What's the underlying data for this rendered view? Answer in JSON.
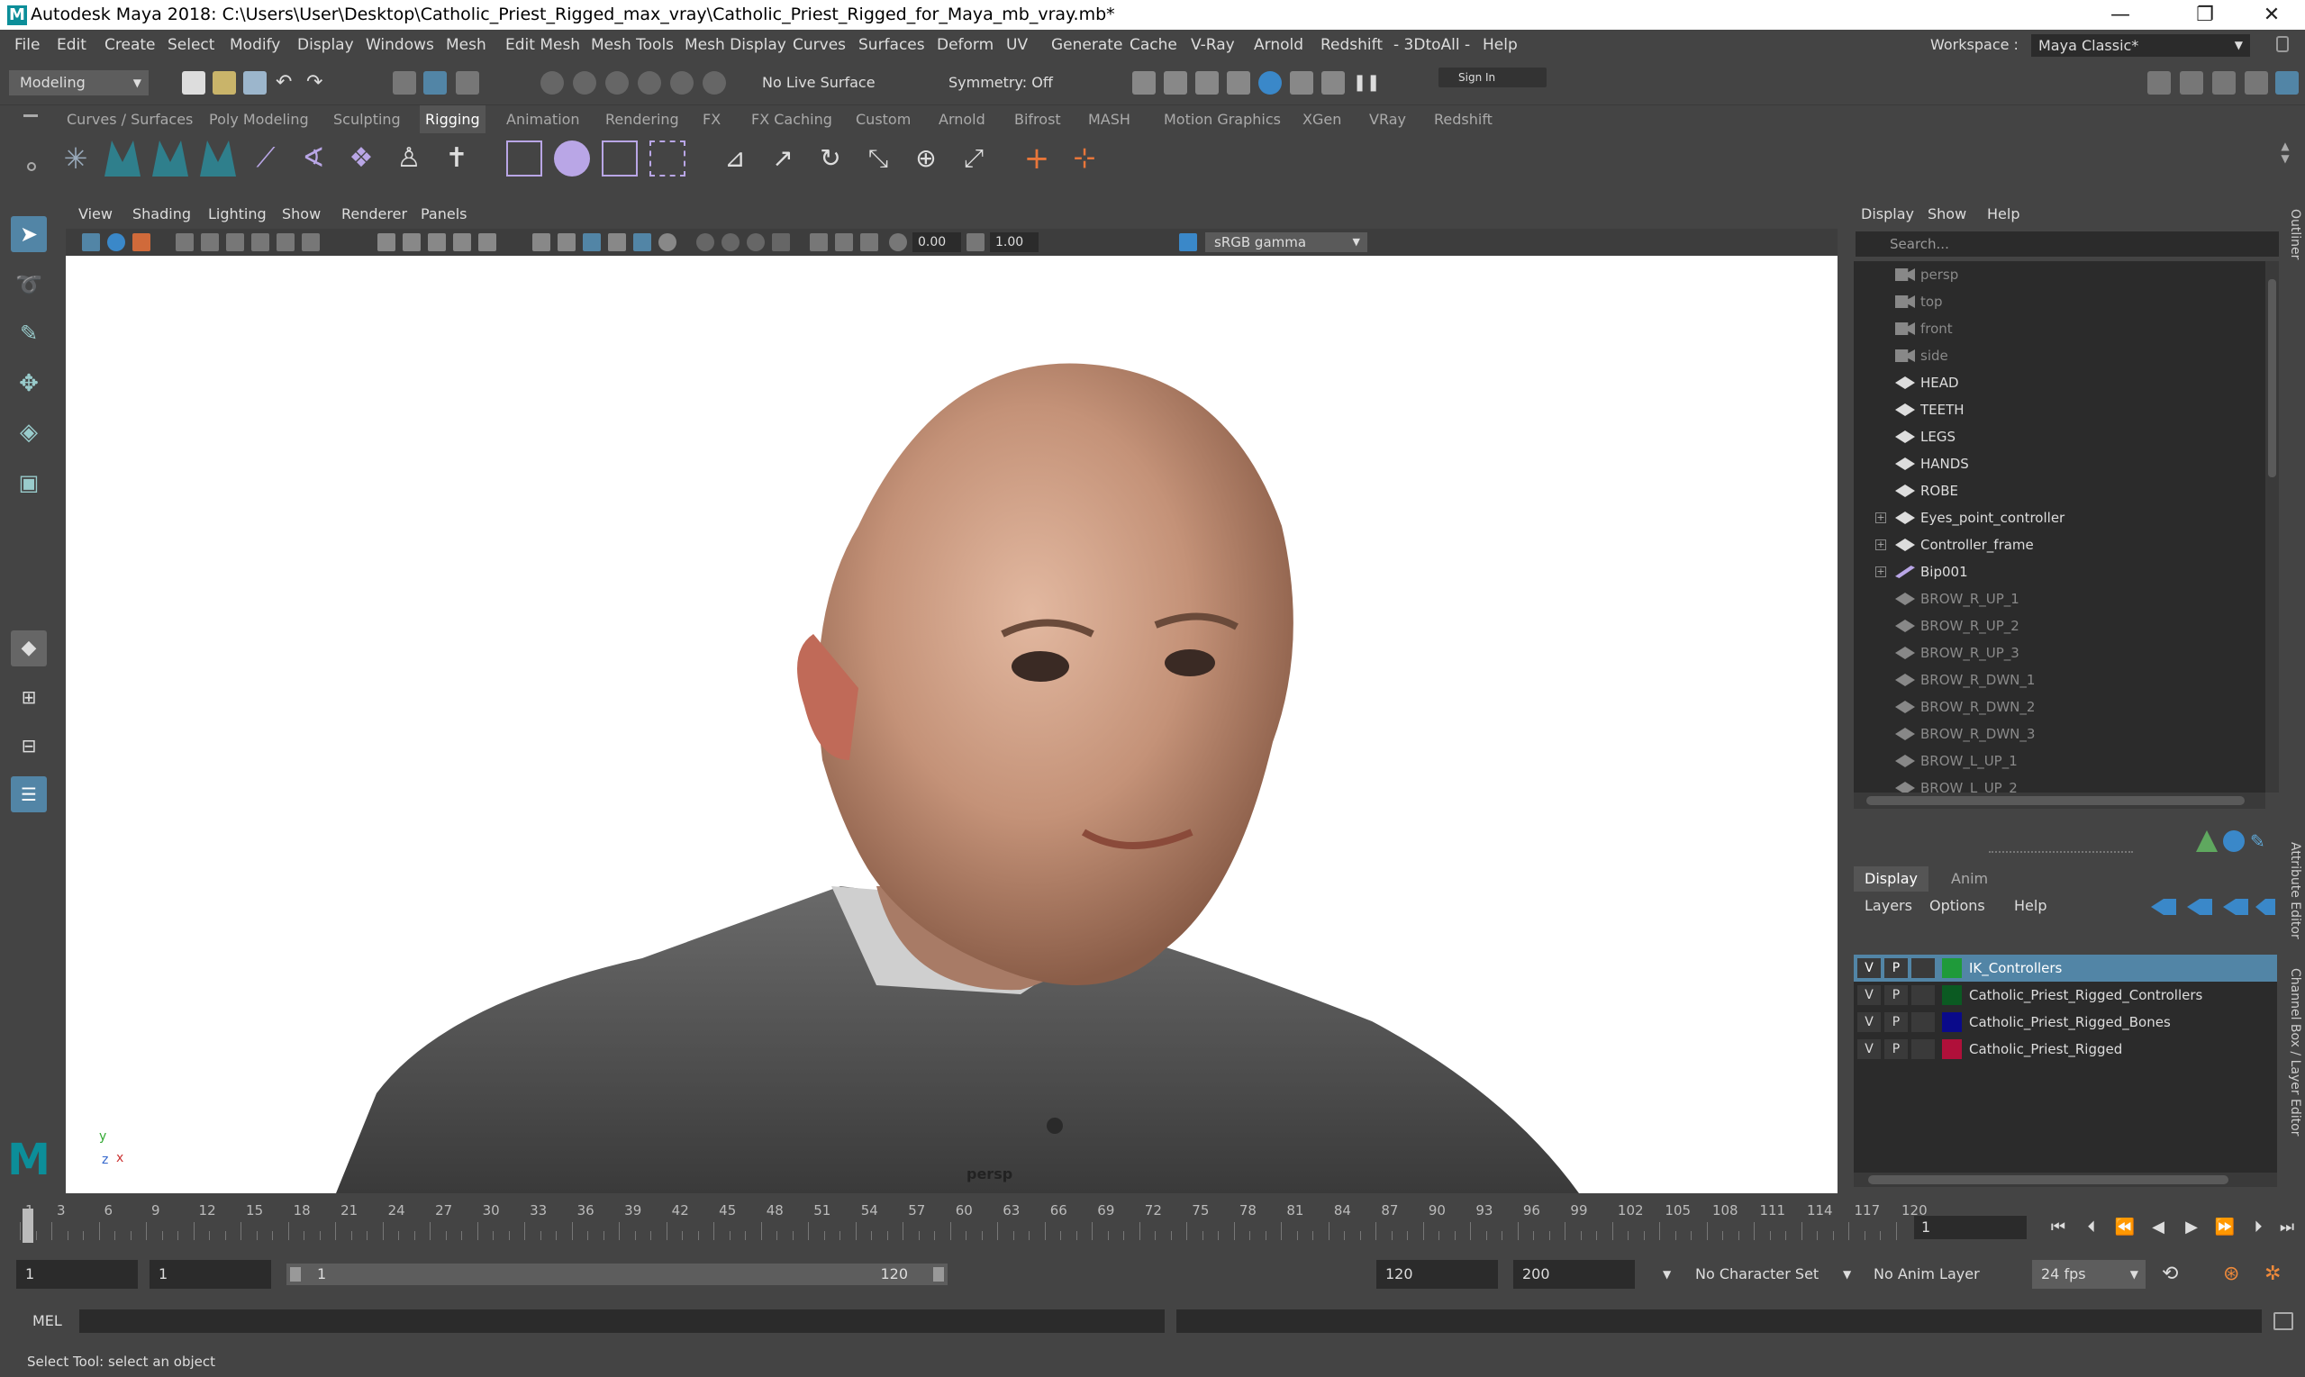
{
  "window": {
    "title": "Autodesk Maya 2018: C:\\Users\\User\\Desktop\\Catholic_Priest_Rigged_max_vray\\Catholic_Priest_Rigged_for_Maya_mb_vray.mb*",
    "logo_letter": "M",
    "minimize": "—",
    "restore": "❐",
    "close": "✕"
  },
  "main_menu": [
    "File",
    "Edit",
    "Create",
    "Select",
    "Modify",
    "Display",
    "Windows",
    "Mesh",
    "Edit Mesh",
    "Mesh Tools",
    "Mesh Display",
    "Curves",
    "Surfaces",
    "Deform",
    "UV",
    "Generate",
    "Cache",
    "V-Ray",
    "Arnold",
    "Redshift",
    "- 3DtoAll -",
    "Help"
  ],
  "workspace": {
    "label": "Workspace :",
    "value": "Maya Classic*"
  },
  "status_line": {
    "mode": "Modeling",
    "live_surface": "No Live Surface",
    "symmetry": "Symmetry: Off",
    "sign_in": "Sign In"
  },
  "shelf_tabs": [
    "Curves / Surfaces",
    "Poly Modeling",
    "Sculpting",
    "Rigging",
    "Animation",
    "Rendering",
    "FX",
    "FX Caching",
    "Custom",
    "Arnold",
    "Bifrost",
    "MASH",
    "Motion Graphics",
    "XGen",
    "VRay",
    "Redshift"
  ],
  "shelf_active": "Rigging",
  "viewport": {
    "menu": [
      "View",
      "Shading",
      "Lighting",
      "Show",
      "Renderer",
      "Panels"
    ],
    "exposure": "0.00",
    "gamma": "1.00",
    "color_space": "sRGB gamma",
    "camera_label": "persp",
    "axis": {
      "y": "y",
      "z": "z",
      "x": "x"
    }
  },
  "outliner": {
    "menu": [
      "Display",
      "Show",
      "Help"
    ],
    "search_placeholder": "Search...",
    "side_label": "Outliner",
    "items": [
      {
        "label": "persp",
        "type": "camera",
        "dim": true,
        "expand": false
      },
      {
        "label": "top",
        "type": "camera",
        "dim": true,
        "expand": false
      },
      {
        "label": "front",
        "type": "camera",
        "dim": true,
        "expand": false
      },
      {
        "label": "side",
        "type": "camera",
        "dim": true,
        "expand": false
      },
      {
        "label": "HEAD",
        "type": "mesh",
        "dim": false,
        "expand": false
      },
      {
        "label": "TEETH",
        "type": "mesh",
        "dim": false,
        "expand": false
      },
      {
        "label": "LEGS",
        "type": "mesh",
        "dim": false,
        "expand": false
      },
      {
        "label": "HANDS",
        "type": "mesh",
        "dim": false,
        "expand": false
      },
      {
        "label": "ROBE",
        "type": "mesh",
        "dim": false,
        "expand": false
      },
      {
        "label": "Eyes_point_controller",
        "type": "mesh",
        "dim": false,
        "expand": true
      },
      {
        "label": "Controller_frame",
        "type": "mesh",
        "dim": false,
        "expand": true
      },
      {
        "label": "Bip001",
        "type": "joint",
        "dim": false,
        "expand": true
      },
      {
        "label": "BROW_R_UP_1",
        "type": "mesh",
        "dim": true,
        "expand": false
      },
      {
        "label": "BROW_R_UP_2",
        "type": "mesh",
        "dim": true,
        "expand": false
      },
      {
        "label": "BROW_R_UP_3",
        "type": "mesh",
        "dim": true,
        "expand": false
      },
      {
        "label": "BROW_R_DWN_1",
        "type": "mesh",
        "dim": true,
        "expand": false
      },
      {
        "label": "BROW_R_DWN_2",
        "type": "mesh",
        "dim": true,
        "expand": false
      },
      {
        "label": "BROW_R_DWN_3",
        "type": "mesh",
        "dim": true,
        "expand": false
      },
      {
        "label": "BROW_L_UP_1",
        "type": "mesh",
        "dim": true,
        "expand": false
      },
      {
        "label": "BROW_L_UP_2",
        "type": "mesh",
        "dim": true,
        "expand": false
      }
    ]
  },
  "side_labels": {
    "attribute_editor": "Attribute Editor",
    "channel_box": "Channel Box / Layer Editor"
  },
  "layer_editor": {
    "tabs": [
      "Display",
      "Anim"
    ],
    "menu": [
      "Layers",
      "Options",
      "Help"
    ],
    "layers": [
      {
        "v": "V",
        "p": "P",
        "name": "IK_Controllers",
        "color": "#1f9a3a",
        "selected": true
      },
      {
        "v": "V",
        "p": "P",
        "name": "Catholic_Priest_Rigged_Controllers",
        "color": "#0b5a22",
        "selected": false
      },
      {
        "v": "V",
        "p": "P",
        "name": "Catholic_Priest_Rigged_Bones",
        "color": "#0a0a8a",
        "selected": false
      },
      {
        "v": "V",
        "p": "P",
        "name": "Catholic_Priest_Rigged",
        "color": "#b0103a",
        "selected": false
      }
    ]
  },
  "time_slider": {
    "ticks": [
      "1",
      "3",
      "6",
      "9",
      "12",
      "15",
      "18",
      "21",
      "24",
      "27",
      "30",
      "33",
      "36",
      "39",
      "42",
      "45",
      "48",
      "51",
      "54",
      "57",
      "60",
      "63",
      "66",
      "69",
      "72",
      "75",
      "78",
      "81",
      "84",
      "87",
      "90",
      "93",
      "96",
      "99",
      "102",
      "105",
      "108",
      "111",
      "114",
      "117",
      "120"
    ],
    "current_frame": "1"
  },
  "range_slider": {
    "start": "1",
    "playback_start": "1",
    "bar_start": "1",
    "bar_end": "120",
    "playback_end": "120",
    "end": "200",
    "character_set": "No Character Set",
    "anim_layer": "No Anim Layer",
    "fps": "24 fps"
  },
  "command_line": {
    "label": "MEL"
  },
  "help_line": "Select Tool: select an object",
  "colors": {
    "accent": "#5285a6",
    "bg": "#444444",
    "field": "#2b2b2b",
    "maya_teal": "#0c8e99"
  }
}
